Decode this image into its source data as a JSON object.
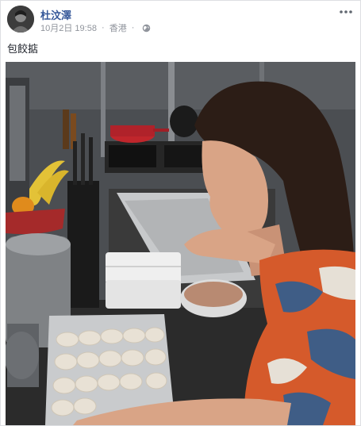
{
  "post": {
    "author": "杜汶澤",
    "date": "10月2日 19:58",
    "separator": "·",
    "location": "香港",
    "privacy_icon": "globe-icon",
    "more_icon": "more-horizontal-icon",
    "text": "包餃掂"
  },
  "photo": {
    "description_icon": "photo",
    "colors": {
      "wall": "#4b4e52",
      "counter": "#2b2b2b",
      "pot": "#c0262c",
      "banana": "#e3c237",
      "hair": "#2c1d16",
      "skin": "#d9a486",
      "shirt_orange": "#d55a2b",
      "shirt_blue": "#3f5d86",
      "foil": "#c7c9cb"
    }
  }
}
